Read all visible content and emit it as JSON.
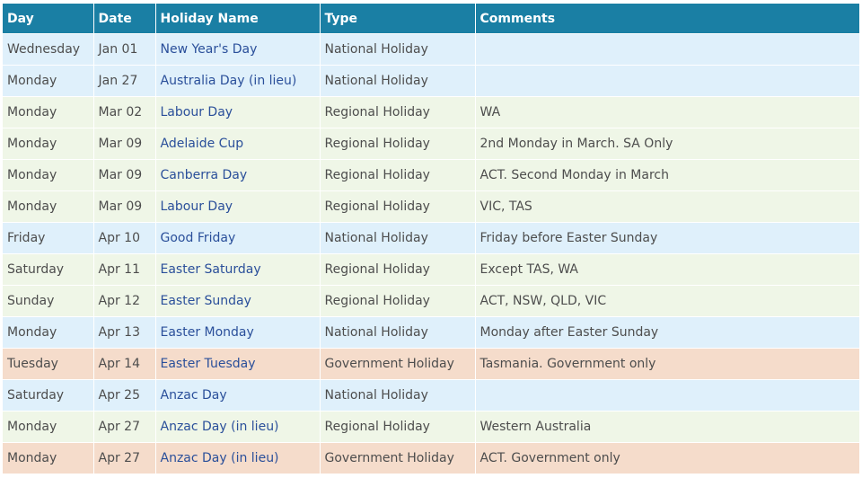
{
  "table": {
    "headers": {
      "day": "Day",
      "date": "Date",
      "name": "Holiday Name",
      "type": "Type",
      "comments": "Comments"
    },
    "colors": {
      "header": "#1a7fa4",
      "national": "#dff0fb",
      "regional": "#eff6e7",
      "government": "#f5dccb",
      "link": "#2a4f9a"
    },
    "rows": [
      {
        "day": "Wednesday",
        "date": "Jan 01",
        "name": "New Year's Day",
        "type": "National Holiday",
        "comments": ""
      },
      {
        "day": "Monday",
        "date": "Jan 27",
        "name": "Australia Day (in lieu)",
        "type": "National Holiday",
        "comments": ""
      },
      {
        "day": "Monday",
        "date": "Mar 02",
        "name": "Labour Day",
        "type": "Regional Holiday",
        "comments": "WA"
      },
      {
        "day": "Monday",
        "date": "Mar 09",
        "name": "Adelaide Cup",
        "type": "Regional Holiday",
        "comments": "2nd Monday in March. SA Only"
      },
      {
        "day": "Monday",
        "date": "Mar 09",
        "name": "Canberra Day",
        "type": "Regional Holiday",
        "comments": "ACT. Second Monday in March"
      },
      {
        "day": "Monday",
        "date": "Mar 09",
        "name": "Labour Day",
        "type": "Regional Holiday",
        "comments": "VIC, TAS"
      },
      {
        "day": "Friday",
        "date": "Apr 10",
        "name": "Good Friday",
        "type": "National Holiday",
        "comments": "Friday before Easter Sunday"
      },
      {
        "day": "Saturday",
        "date": "Apr 11",
        "name": "Easter Saturday",
        "type": "Regional Holiday",
        "comments": "Except TAS, WA"
      },
      {
        "day": "Sunday",
        "date": "Apr 12",
        "name": "Easter Sunday",
        "type": "Regional Holiday",
        "comments": "ACT, NSW, QLD, VIC"
      },
      {
        "day": "Monday",
        "date": "Apr 13",
        "name": "Easter Monday",
        "type": "National Holiday",
        "comments": "Monday after Easter Sunday"
      },
      {
        "day": "Tuesday",
        "date": "Apr 14",
        "name": "Easter Tuesday",
        "type": "Government Holiday",
        "comments": "Tasmania. Government only"
      },
      {
        "day": "Saturday",
        "date": "Apr 25",
        "name": "Anzac Day",
        "type": "National Holiday",
        "comments": ""
      },
      {
        "day": "Monday",
        "date": "Apr 27",
        "name": "Anzac Day (in lieu)",
        "type": "Regional Holiday",
        "comments": "Western Australia"
      },
      {
        "day": "Monday",
        "date": "Apr 27",
        "name": "Anzac Day (in lieu)",
        "type": "Government Holiday",
        "comments": "ACT. Government only"
      }
    ]
  }
}
